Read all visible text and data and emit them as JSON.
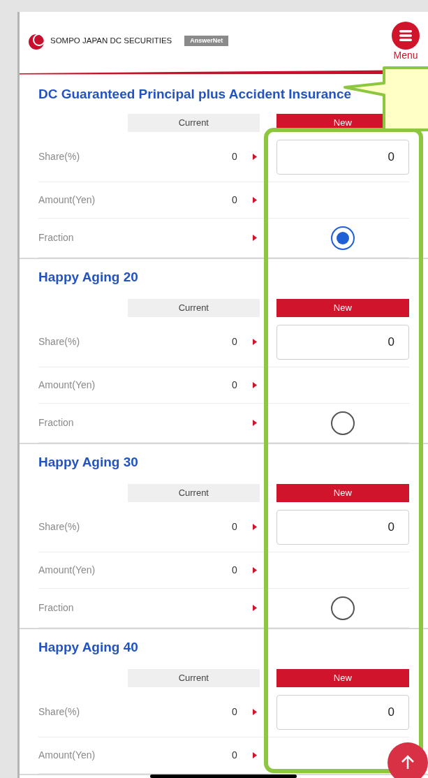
{
  "header": {
    "brand": "SOMPO JAPAN DC SECURITIES",
    "badge": "AnswerNet",
    "menu_label": "Menu"
  },
  "funds": [
    {
      "name": "DC Guaranteed Principal plus Accident Insurance",
      "current_header": "Current",
      "new_header": "New",
      "rows": [
        {
          "kind": "input",
          "label": "Share(%)",
          "current": "0",
          "new_value": "0"
        },
        {
          "kind": "plain",
          "label": "Amount(Yen)",
          "current": "0"
        },
        {
          "kind": "radio",
          "label": "Fraction",
          "selected": true
        }
      ]
    },
    {
      "name": "Happy Aging 20",
      "current_header": "Current",
      "new_header": "New",
      "rows": [
        {
          "kind": "input",
          "label": "Share(%)",
          "current": "0",
          "new_value": "0"
        },
        {
          "kind": "plain",
          "label": "Amount(Yen)",
          "current": "0"
        },
        {
          "kind": "radio",
          "label": "Fraction",
          "selected": false
        }
      ]
    },
    {
      "name": "Happy Aging 30",
      "current_header": "Current",
      "new_header": "New",
      "rows": [
        {
          "kind": "input",
          "label": "Share(%)",
          "current": "0",
          "new_value": "0"
        },
        {
          "kind": "plain",
          "label": "Amount(Yen)",
          "current": "0"
        },
        {
          "kind": "radio",
          "label": "Fraction",
          "selected": false
        }
      ]
    },
    {
      "name": "Happy Aging 40",
      "current_header": "Current",
      "new_header": "New",
      "rows": [
        {
          "kind": "input",
          "label": "Share(%)",
          "current": "0",
          "new_value": "0"
        },
        {
          "kind": "plain",
          "label": "Amount(Yen)",
          "current": "0"
        }
      ]
    }
  ]
}
